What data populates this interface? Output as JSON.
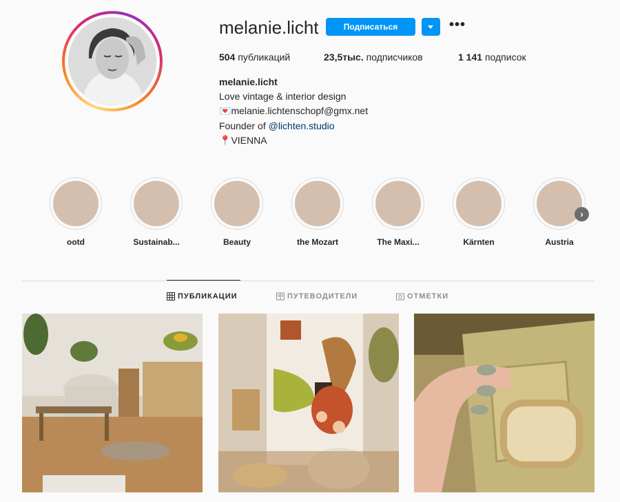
{
  "profile": {
    "username": "melanie.licht",
    "follow_label": "Подписаться",
    "more_glyph": "•••",
    "stats": {
      "posts_count": "504",
      "posts_label": "публикаций",
      "followers_count": "23,5тыс.",
      "followers_label": "подписчиков",
      "following_count": "1 141",
      "following_label": "подписок"
    },
    "bio": {
      "name": "melanie.licht",
      "line1": "Love vintage & interior design",
      "email_emoji": "💌",
      "email": "melanie.lichtenschopf@gmx.net",
      "founder_prefix": "Founder of ",
      "founder_link": "@lichten.studio",
      "location_emoji": "📍",
      "location": "VIENNA"
    }
  },
  "highlights": [
    {
      "label": "ootd"
    },
    {
      "label": "Sustainab..."
    },
    {
      "label": "Beauty"
    },
    {
      "label": "the Mozart"
    },
    {
      "label": "The Maxi..."
    },
    {
      "label": "Kärnten"
    },
    {
      "label": "Austria"
    }
  ],
  "highlight_next_glyph": "›",
  "highlight_color": "#d4bfae",
  "tabs": [
    {
      "label": "ПУБЛИКАЦИИ",
      "icon": "grid-icon",
      "active": true
    },
    {
      "label": "ПУТЕВОДИТЕЛИ",
      "icon": "guide-icon",
      "active": false
    },
    {
      "label": "ОТМЕТКИ",
      "icon": "tagged-icon",
      "active": false
    }
  ],
  "colors": {
    "accent": "#0095f6",
    "link": "#00376b",
    "text": "#262626",
    "muted": "#8e8e8e"
  }
}
